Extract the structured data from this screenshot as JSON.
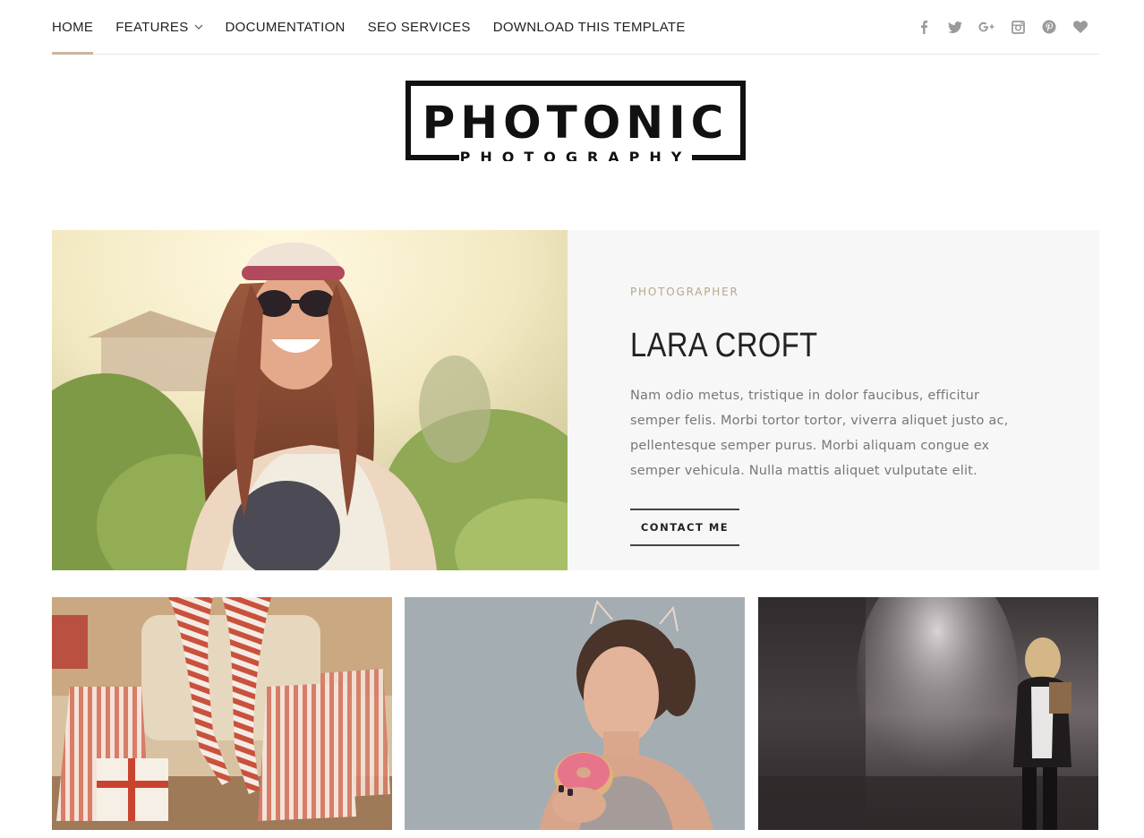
{
  "nav": {
    "items": [
      {
        "label": "HOME",
        "active": true
      },
      {
        "label": "FEATURES",
        "has_dropdown": true
      },
      {
        "label": "DOCUMENTATION"
      },
      {
        "label": "SEO SERVICES"
      },
      {
        "label": "DOWNLOAD THIS TEMPLATE"
      }
    ],
    "social_icons": [
      "facebook-icon",
      "twitter-icon",
      "google-plus-icon",
      "instagram-icon",
      "pinterest-icon",
      "heart-icon"
    ]
  },
  "logo": {
    "title": "PHOTONIC",
    "subtitle": "PHOTOGRAPHY"
  },
  "hero": {
    "eyebrow": "PHOTOGRAPHER",
    "name": "LARA CROFT",
    "bio": "Nam odio metus, tristique in dolor faucibus, efficitur semper felis. Morbi tortor tortor, viverra aliquet justo ac, pellentesque semper purus. Morbi aliquam congue ex semper vehicula. Nulla mattis aliquet vulputate elit.",
    "cta_label": "CONTACT ME"
  },
  "colors": {
    "accent": "#c8b79b",
    "eyebrow": "#b6a78c",
    "hero_bg": "#f7f7f7",
    "text": "#222222",
    "muted": "#777777"
  }
}
